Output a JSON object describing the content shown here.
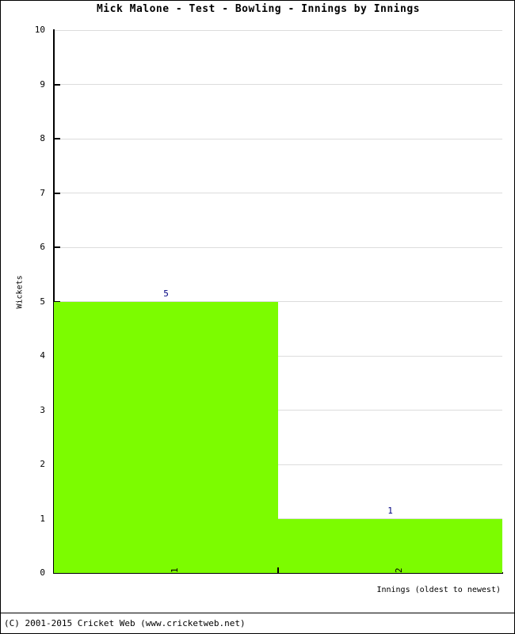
{
  "chart_data": {
    "type": "bar",
    "title": "Mick Malone - Test - Bowling - Innings by Innings",
    "xlabel": "Innings (oldest to newest)",
    "ylabel": "Wickets",
    "categories": [
      "1",
      "2"
    ],
    "values": [
      5,
      1
    ],
    "data_labels": [
      "5",
      "1"
    ],
    "ylim": [
      0,
      10
    ],
    "ytick_labels": [
      "0",
      "1",
      "2",
      "3",
      "4",
      "5",
      "6",
      "7",
      "8",
      "9",
      "10"
    ],
    "ytick_values": [
      0,
      1,
      2,
      3,
      4,
      5,
      6,
      7,
      8,
      9,
      10
    ],
    "grid": true,
    "legend": false,
    "series": [
      {
        "name": "Wickets",
        "values": [
          5,
          1
        ]
      }
    ],
    "colors": {
      "bar": "#7CFC00",
      "data_label": "#000080",
      "gridline": "#DCDCDC",
      "axis": "#000000",
      "background": "#FFFFFF"
    }
  },
  "footer": {
    "copyright": "(C) 2001-2015 Cricket Web (www.cricketweb.net)"
  }
}
